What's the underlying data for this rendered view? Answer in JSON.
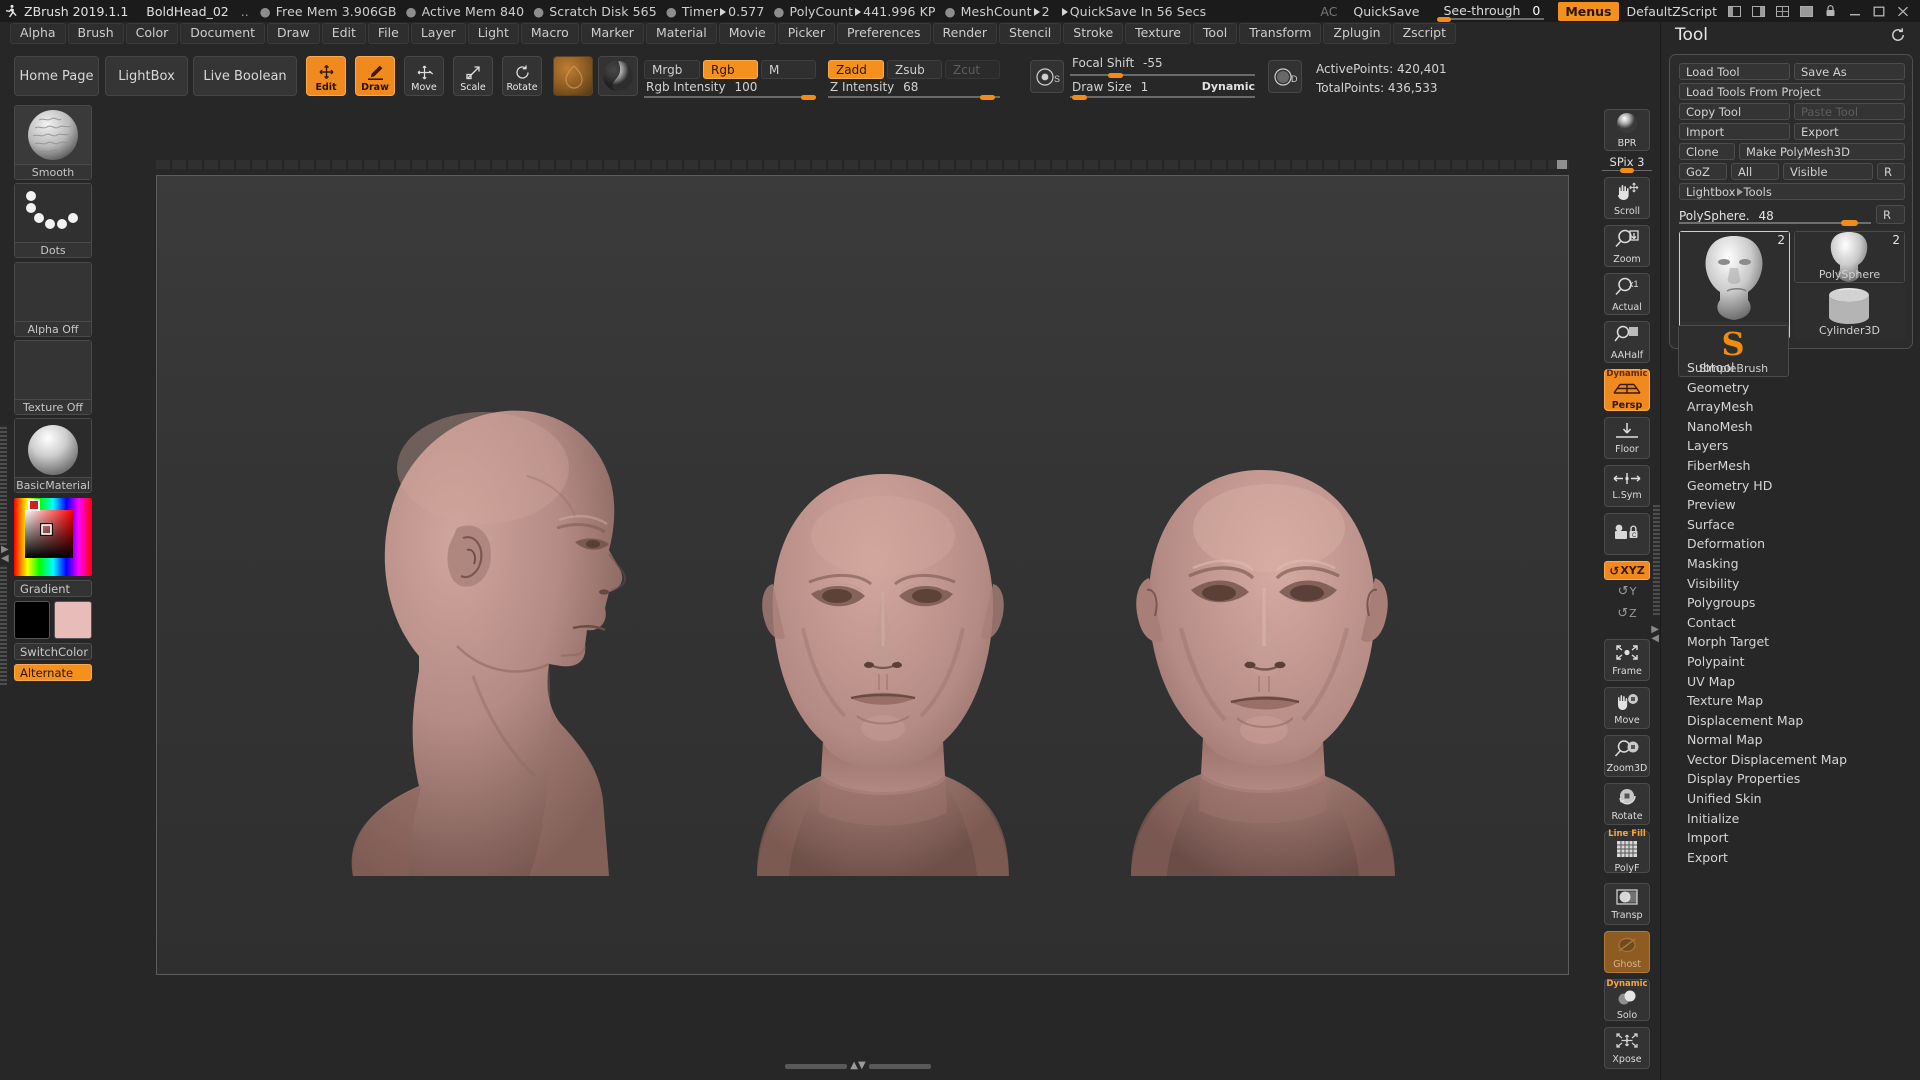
{
  "titlebar": {
    "logo_icon": "zbrush-logo-icon",
    "app_name": "ZBrush 2019.1.1",
    "document": "BoldHead_02",
    "dots": "..",
    "free_mem": "Free Mem 3.906GB",
    "active_mem": "Active Mem 840",
    "scratch_disk": "Scratch Disk 565",
    "timer_label": "Timer",
    "timer_value": "0.577",
    "polycount_label": "PolyCount",
    "polycount_value": "441.996 KP",
    "meshcount_label": "MeshCount",
    "meshcount_value": "2",
    "quicksave_status": "QuickSave In 56 Secs",
    "ac": "AC",
    "quicksave": "QuickSave",
    "seethrough_label": "See-through",
    "seethrough_value": "0",
    "menus": "Menus",
    "script": "DefaultZScript"
  },
  "menubar": {
    "items": [
      "Alpha",
      "Brush",
      "Color",
      "Document",
      "Draw",
      "Edit",
      "File",
      "Layer",
      "Light",
      "Macro",
      "Marker",
      "Material",
      "Movie",
      "Picker",
      "Preferences",
      "Render",
      "Stencil",
      "Stroke",
      "Texture",
      "Tool",
      "Transform",
      "Zplugin",
      "Zscript"
    ]
  },
  "toolbar": {
    "home_page": "Home Page",
    "lightbox": "LightBox",
    "live_boolean": "Live Boolean",
    "edit": "Edit",
    "draw": "Draw",
    "move": "Move",
    "scale": "Scale",
    "rotate": "Rotate",
    "brush_icon": "brush-thumbnail-icon",
    "material_icon": "material-sphere-icon",
    "mrgb": "Mrgb",
    "rgb": "Rgb",
    "m": "M",
    "zadd": "Zadd",
    "zsub": "Zsub",
    "zcut": "Zcut",
    "rgb_intensity_label": "Rgb Intensity",
    "rgb_intensity_value": "100",
    "z_intensity_label": "Z Intensity",
    "z_intensity_value": "68",
    "focal_shift_label": "Focal Shift",
    "focal_shift_value": "-55",
    "draw_size_label": "Draw Size",
    "draw_size_value": "1",
    "dynamic": "Dynamic",
    "s_icon": "focal-shift-icon",
    "d_icon": "draw-size-icon",
    "active_points": "ActivePoints: 420,401",
    "total_points": "TotalPoints: 436,533"
  },
  "leftbar": {
    "slots": [
      {
        "name": "Smooth",
        "icon": "brush-smooth-thumbnail"
      },
      {
        "name": "Dots",
        "icon": "stroke-dots-thumbnail"
      },
      {
        "name": "Alpha Off",
        "icon": "alpha-off-thumbnail"
      },
      {
        "name": "Texture Off",
        "icon": "texture-off-thumbnail"
      },
      {
        "name": "BasicMaterial",
        "icon": "material-basic-thumbnail"
      }
    ],
    "gradient": "Gradient",
    "switch_color": "SwitchColor",
    "alternate": "Alternate",
    "main_color": "#000000",
    "secondary_color": "#e8bdb9",
    "picker_icon": "color-picker-icon"
  },
  "rightbar": {
    "items": [
      {
        "label": "BPR",
        "icon": "bpr-render-icon",
        "state": "normal"
      },
      {
        "label": "Scroll",
        "icon": "scroll-hand-icon",
        "state": "normal"
      },
      {
        "label": "Zoom",
        "icon": "zoom-magnifier-icon",
        "state": "normal"
      },
      {
        "label": "Actual",
        "icon": "actual-size-icon",
        "state": "normal"
      },
      {
        "label": "AAHalf",
        "icon": "aahalf-icon",
        "state": "normal"
      },
      {
        "label": "Persp",
        "icon": "perspective-grid-icon",
        "state": "active",
        "tag": "Dynamic"
      },
      {
        "label": "Floor",
        "icon": "floor-grid-icon",
        "state": "normal"
      },
      {
        "label": "L.Sym",
        "icon": "local-symmetry-icon",
        "state": "normal"
      },
      {
        "label": "",
        "icon": "lock-camera-icon",
        "state": "normal"
      },
      {
        "label": "Frame",
        "icon": "frame-icon",
        "state": "normal"
      },
      {
        "label": "Move",
        "icon": "move-hand-icon",
        "state": "normal"
      },
      {
        "label": "Zoom3D",
        "icon": "zoom3d-icon",
        "state": "normal"
      },
      {
        "label": "Rotate",
        "icon": "rotate-icon",
        "state": "normal"
      },
      {
        "label": "PolyF",
        "icon": "polyframe-icon",
        "state": "normal",
        "tag": "Line Fill"
      },
      {
        "label": "Transp",
        "icon": "transparency-icon",
        "state": "normal"
      },
      {
        "label": "Ghost",
        "icon": "ghost-icon",
        "state": "brown"
      },
      {
        "label": "Solo",
        "icon": "solo-icon",
        "state": "normal",
        "tag": "Dynamic"
      },
      {
        "label": "Xpose",
        "icon": "xpose-icon",
        "state": "normal"
      }
    ],
    "spix_label": "SPix",
    "spix_value": "3",
    "axis": {
      "xyz": "XYZ",
      "y": "Y",
      "z": "Z"
    }
  },
  "toolpanel": {
    "title": "Tool",
    "reload_icon": "reload-icon",
    "buttons": {
      "load_tool": "Load Tool",
      "save_as": "Save As",
      "load_tools_from_project": "Load Tools From Project",
      "copy_tool": "Copy Tool",
      "paste_tool": "Paste Tool",
      "import": "Import",
      "export": "Export",
      "clone": "Clone",
      "make_polymesh3d": "Make PolyMesh3D",
      "goz": "GoZ",
      "all": "All",
      "visible": "Visible",
      "r": "R",
      "lightbox_tools": "Lightbox",
      "lightbox_tools_sub": "Tools"
    },
    "slider": {
      "label": "PolySphere.",
      "value": "48",
      "r": "R"
    },
    "thumbs": [
      {
        "name": "PolySphere",
        "count": "2",
        "icon": "polysphere-head-thumbnail",
        "selected": true
      },
      {
        "name": "PolySphere",
        "count": "2",
        "icon": "polysphere-head-thumbnail",
        "selected": false
      },
      {
        "name": "Cylinder3D",
        "count": "",
        "icon": "cylinder3d-thumbnail",
        "selected": false
      },
      {
        "name": "SimpleBrush",
        "count": "",
        "icon": "simplebrush-thumbnail",
        "selected": false
      }
    ],
    "sections": [
      "Subtool",
      "Geometry",
      "ArrayMesh",
      "NanoMesh",
      "Layers",
      "FiberMesh",
      "Geometry HD",
      "Preview",
      "Surface",
      "Deformation",
      "Masking",
      "Visibility",
      "Polygroups",
      "Contact",
      "Morph Target",
      "Polypaint",
      "UV Map",
      "Texture Map",
      "Displacement Map",
      "Normal Map",
      "Vector Displacement Map",
      "Display Properties",
      "Unified Skin",
      "Initialize",
      "Import",
      "Export"
    ]
  },
  "canvas": {
    "models": [
      {
        "name": "head-profile-view",
        "view": "profile"
      },
      {
        "name": "head-front-view",
        "view": "front"
      },
      {
        "name": "head-three-quarter-view",
        "view": "three-quarter"
      }
    ],
    "skin_color": "#b08a84"
  },
  "colors": {
    "accent": "#f4911e",
    "panel_bg": "#272727",
    "titlebar_bg": "#1b1b1b",
    "canvas_bg": "#343434"
  }
}
